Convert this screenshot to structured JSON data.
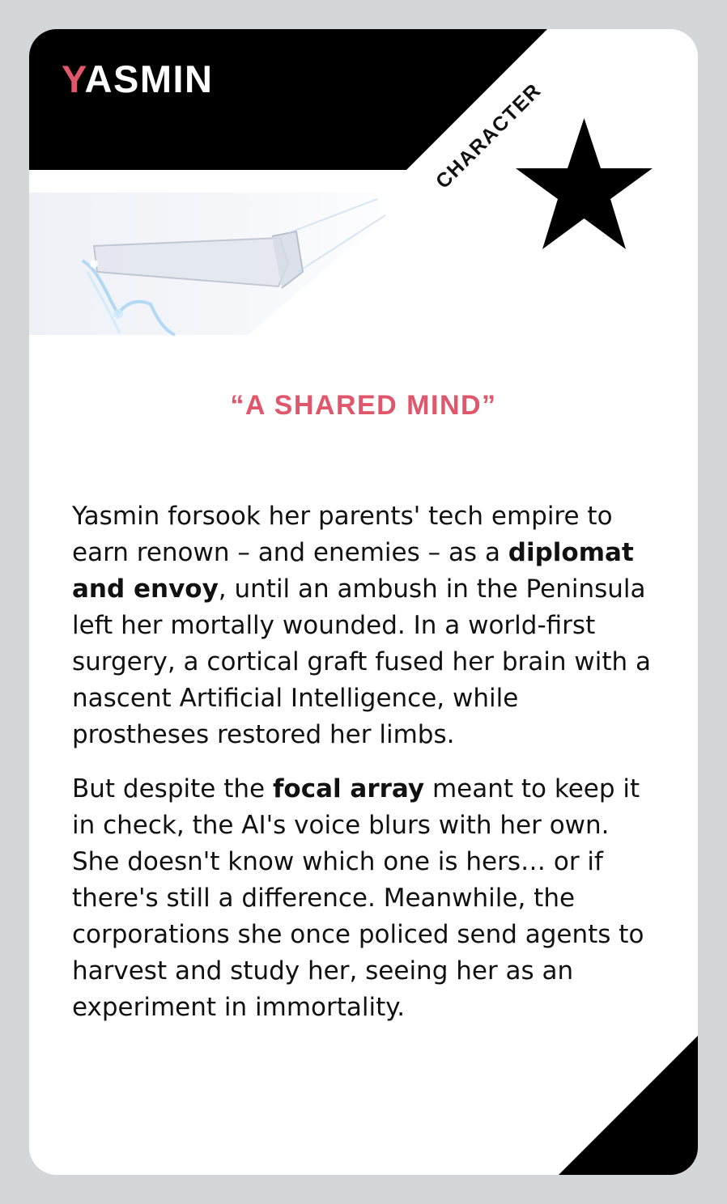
{
  "card": {
    "name_initial": "Y",
    "name_rest": "ASMIN",
    "type": "CHARACTER",
    "type_icon": "star-icon",
    "tagline": "“A SHARED MIND”",
    "paragraphs": [
      [
        {
          "text": "Yasmin forsook her parents' tech empire to earn renown – and enemies – as a ",
          "bold": false
        },
        {
          "text": "diplomat and envoy",
          "bold": true
        },
        {
          "text": ", until an ambush in the Peninsula left her mortally wounded. In a world-first surgery, a cortical graft fused her brain with a nascent Artificial Intelligence, while prostheses restored her limbs.",
          "bold": false
        }
      ],
      [
        {
          "text": "But despite the ",
          "bold": false
        },
        {
          "text": "focal array",
          "bold": true
        },
        {
          "text": " meant to keep it in check, the AI's voice blurs with her own. She doesn't know which one is hers… or if there's still a difference. Meanwhile, the corporations she once policed send agents to harvest and study her, seeing her as an experiment in immortality.",
          "bold": false
        }
      ]
    ]
  },
  "colors": {
    "accent": "#e0566a",
    "ink": "#000000",
    "card_bg": "#ffffff",
    "page_bg": "#d4d7d8"
  }
}
